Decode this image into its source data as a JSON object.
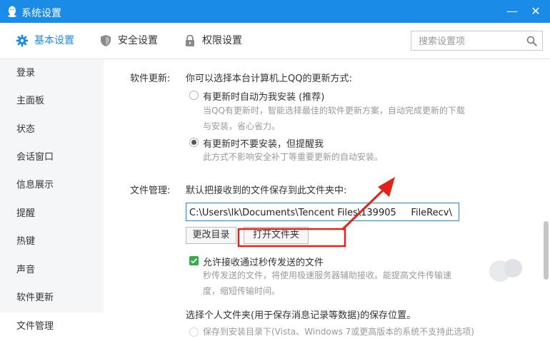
{
  "window": {
    "title": "系统设置",
    "minimize_glyph": "—",
    "close_glyph": "✕"
  },
  "tabs": [
    {
      "label": "基本设置",
      "icon": "gear-icon",
      "active": true
    },
    {
      "label": "安全设置",
      "icon": "shield-icon",
      "active": false
    },
    {
      "label": "权限设置",
      "icon": "lock-icon",
      "active": false
    }
  ],
  "search": {
    "placeholder": "搜索设置项",
    "value": ""
  },
  "sidebar": {
    "items": [
      {
        "label": "登录"
      },
      {
        "label": "主面板"
      },
      {
        "label": "状态"
      },
      {
        "label": "会话窗口"
      },
      {
        "label": "信息展示"
      },
      {
        "label": "提醒"
      },
      {
        "label": "热键"
      },
      {
        "label": "声音"
      },
      {
        "label": "软件更新"
      },
      {
        "label": "文件管理",
        "active": true
      }
    ]
  },
  "software_update": {
    "label": "软件更新:",
    "prompt": "你可以选择本台计算机上QQ的更新方式:",
    "option_auto": {
      "label": "有更新时自动为我安装 (推荐)",
      "desc_line1": "当QQ有更新时，智能选择最佳的软件更新方案，自动完成更新的下载",
      "desc_line2": "与安装，省心省力。",
      "checked": false
    },
    "option_notify": {
      "label": "有更新时不要安装，但提醒我",
      "desc": "此方式不影响安全补丁等重要更新的自动安装。",
      "checked": true
    }
  },
  "file_management": {
    "label": "文件管理:",
    "prompt": "默认把接收到的文件保存到此文件夹中:",
    "path_value": "C:\\Users\\lk\\Documents\\Tencent Files\\139905     FileRecv\\",
    "change_dir_button": "更改目录",
    "open_folder_button": "打开文件夹",
    "allow_transfer": {
      "label": "允许接收通过秒传发送的文件",
      "checked": true,
      "desc_line1": "秒传发送的文件，将使用极速服务器辅助接收。能提高文件传输速",
      "desc_line2": "度，缩短传输时间。"
    },
    "personal_folder_prompt": "选择个人文件夹(用于保存消息记录等数据)的保存位置。",
    "save_install_dir_option": "保存到安装目录下(Vista、Windows 7或更高版本的系统不支持此选项)"
  },
  "colors": {
    "accent": "#1a8be6",
    "annotation_red": "#e0241c",
    "checkbox_green": "#2fae4a"
  }
}
